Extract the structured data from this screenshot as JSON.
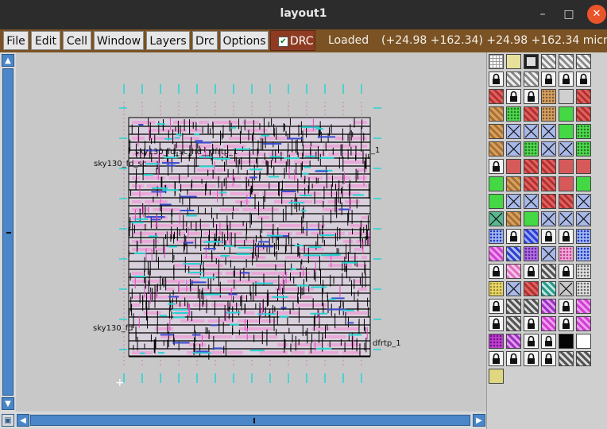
{
  "window": {
    "title": "layout1"
  },
  "titlebar": {
    "minimize": "–",
    "maximize": "□",
    "close": "✕"
  },
  "menubar": {
    "items": [
      {
        "label": "File"
      },
      {
        "label": "Edit"
      },
      {
        "label": "Cell"
      },
      {
        "label": "Window"
      },
      {
        "label": "Layers"
      },
      {
        "label": "Drc"
      },
      {
        "label": "Options"
      }
    ],
    "drc": {
      "label": "DRC",
      "checked": true
    },
    "status": "Loaded",
    "coords": "(+24.98 +162.34) +24.98 +162.34 microns"
  },
  "canvas": {
    "cell_labels": [
      "sky130_fd_sc_hd__dfrtp_1",
      "sky130_fd_sc",
      "sky130_fd",
      "dfrtp_1",
      "_1"
    ]
  },
  "scrollbars": {
    "up": "▲",
    "down": "▼",
    "left": "◀",
    "right": "▶"
  },
  "colors": {
    "titlebar": "#2c2c2c",
    "menubar": "#7a5224",
    "drc_bg": "#8e3b22",
    "scroll": "#4a86c8",
    "canvas": "#c8c8c8",
    "layout_pink": "#e8a9d8",
    "layout_cyan": "#26d3d3",
    "layout_black": "#000000",
    "layout_magenta": "#e040c0",
    "layout_blue": "#3a4ccf"
  },
  "palette": {
    "swatches": [
      "grid",
      "solid-yellow",
      "outline-box",
      "hatch-gray",
      "hatch-gray",
      "hatch-gray",
      "lock",
      "hatch-gray",
      "hatch-gray",
      "lock",
      "lock",
      "lock",
      "red-hatch",
      "lock",
      "lock",
      "tan-dots",
      "plain-gray",
      "red-hatch",
      "brown-hatch",
      "green-dots",
      "red-hatch",
      "tan-dots",
      "green-solid",
      "red-hatch",
      "brown-hatch",
      "x-box-blue",
      "x-box-blue",
      "x-box-blue",
      "green-solid",
      "green-dots",
      "brown-hatch",
      "x-box-blue",
      "green-dots",
      "x-box-blue",
      "x-box-blue",
      "green-dots",
      "lock",
      "red-solid",
      "red-hatch",
      "red-hatch",
      "red-solid",
      "red-solid",
      "green-solid",
      "brown-hatch",
      "red-hatch",
      "red-hatch",
      "red-solid",
      "green-solid",
      "green-solid",
      "x-box-blue",
      "x-box-blue",
      "red-hatch",
      "red-hatch",
      "x-box-blue",
      "x-box-green",
      "brown-hatch",
      "green-solid",
      "x-box-blue",
      "x-box-blue",
      "x-box-blue",
      "blue-dots",
      "lock",
      "blue-wave",
      "lock",
      "lock",
      "blue-dots",
      "magenta-hatch",
      "blue-hatch",
      "magenta-dots",
      "x-box-blue",
      "pink-dots",
      "blue-dots",
      "lock",
      "pink-hatch",
      "lock",
      "gray-hatch",
      "lock",
      "gray-dots",
      "yellow-dots",
      "x-box-blue",
      "red-hatch",
      "teal-hatch",
      "x-box-gray",
      "gray-dots",
      "lock",
      "gray-hatch",
      "gray-hatch",
      "purple-hatch",
      "lock",
      "magenta-hatch",
      "lock",
      "gray-hatch",
      "lock",
      "magenta-hatch",
      "lock",
      "magenta-hatch",
      "purple-dots",
      "purple-hatch",
      "lock",
      "lock",
      "black-solid",
      "plain-white",
      "lock",
      "lock",
      "lock",
      "lock",
      "gray-hatch",
      "gray-hatch",
      "yellow-solid"
    ]
  }
}
